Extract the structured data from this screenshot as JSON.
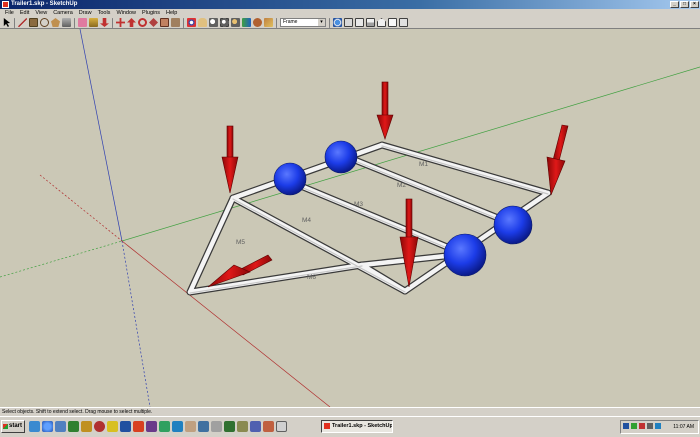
{
  "window": {
    "title": "Trailer1.skp - SketchUp",
    "controls": [
      "_",
      "□",
      "×"
    ]
  },
  "menu": [
    "File",
    "Edit",
    "View",
    "Camera",
    "Draw",
    "Tools",
    "Window",
    "Plugins",
    "Help"
  ],
  "toolbar": {
    "style_select_value": "Frame"
  },
  "model": {
    "member_labels": [
      "M1",
      "M2",
      "M3",
      "M4",
      "M5",
      "M6"
    ]
  },
  "status_bar": {
    "text": "Select objects. Shift to extend select. Drag mouse to select multiple."
  },
  "taskbar": {
    "start_label": "start",
    "task_item_label": "Trailer1.skp - SketchUp",
    "clock": "11:07 AM"
  },
  "colors": {
    "viewport_bg": "#cbc8b6",
    "axis_red": "#b03030",
    "axis_green": "#40a040",
    "axis_blue": "#3040b0",
    "node_blue": "#1838e0",
    "load_arrow_red": "#cc1010",
    "member_white": "#f4f4f4"
  }
}
